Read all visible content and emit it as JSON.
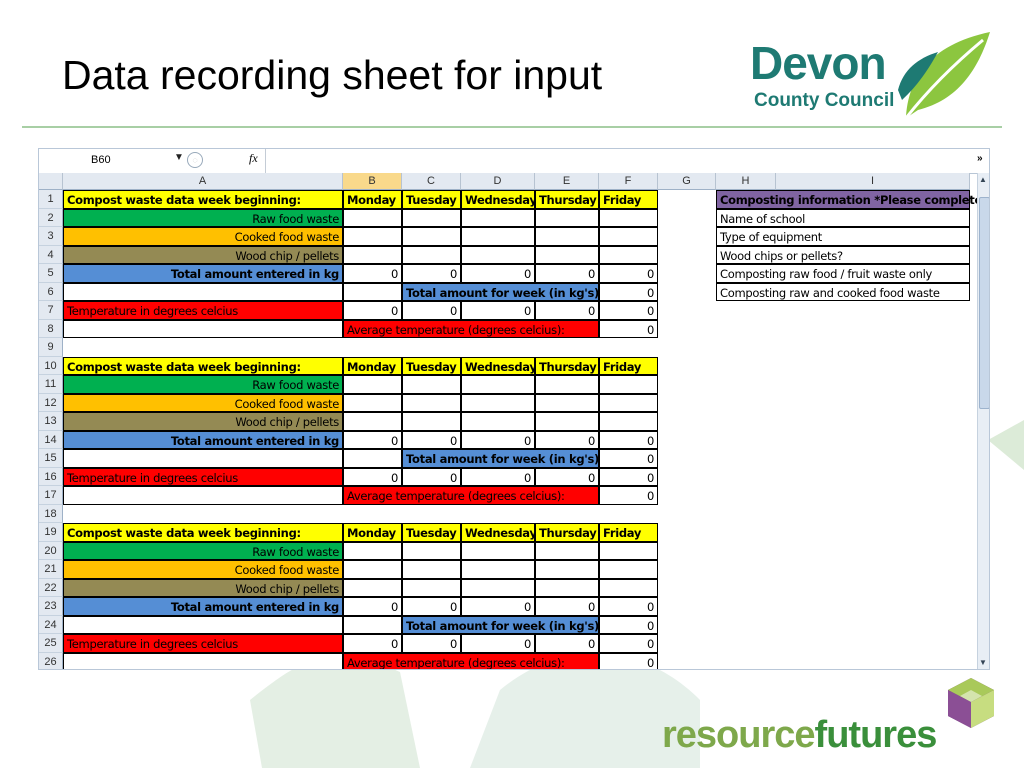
{
  "slide": {
    "title": "Data recording sheet for input"
  },
  "logos": {
    "devon_line1": "Devon",
    "devon_line2": "County Council",
    "resource_a": "resource",
    "resource_b": "futures"
  },
  "formula_bar": {
    "name_box": "B60",
    "fx_label": "fx"
  },
  "columns": [
    {
      "label": "A",
      "w": 280
    },
    {
      "label": "B",
      "w": 59
    },
    {
      "label": "C",
      "w": 59
    },
    {
      "label": "D",
      "w": 74
    },
    {
      "label": "E",
      "w": 64
    },
    {
      "label": "F",
      "w": 59
    },
    {
      "label": "G",
      "w": 58
    },
    {
      "label": "H",
      "w": 60
    },
    {
      "label": "I",
      "w": 194
    }
  ],
  "weekdays": [
    "Monday",
    "Tuesday",
    "Wednesday",
    "Thursday",
    "Friday"
  ],
  "labels": {
    "week_beginning": "Compost waste data week beginning:",
    "raw": "Raw food waste",
    "cooked": "Cooked food waste",
    "wood": "Wood chip / pellets",
    "total_kg": "Total amount entered in kg",
    "total_week": "Total amount for week (in kg's)",
    "temperature": "Temperature in degrees celcius",
    "avg_temp": "Average temperature (degrees celcius):",
    "zero": "0"
  },
  "info_panel": {
    "header": "Composting information *Please complete:",
    "items": [
      "Name of school",
      "Type of equipment",
      "Wood chips or pellets?",
      "Composting raw food / fruit waste only",
      "Composting raw and cooked food waste"
    ]
  },
  "row_numbers": [
    "1",
    "2",
    "3",
    "4",
    "5",
    "6",
    "7",
    "8",
    "9",
    "10",
    "11",
    "12",
    "13",
    "14",
    "15",
    "16",
    "17",
    "18",
    "19",
    "20",
    "21",
    "22",
    "23",
    "24",
    "25",
    "26"
  ],
  "colors": {
    "yellow": "#ffff00",
    "green": "#00b050",
    "orange": "#ffc000",
    "olive": "#948a54",
    "blue": "#558ed5",
    "red": "#ff0000",
    "purple": "#8064a2",
    "devon_teal": "#1e7a73"
  }
}
